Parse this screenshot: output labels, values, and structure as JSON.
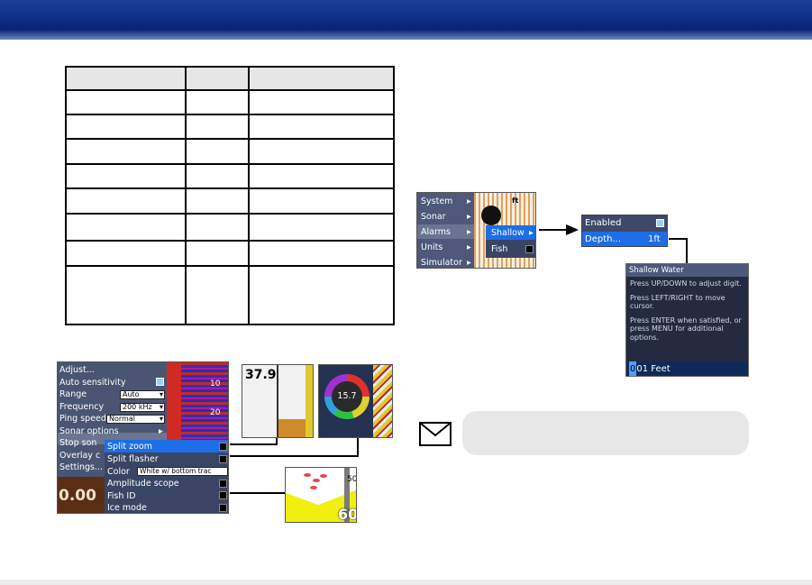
{
  "sonar_menu": {
    "items": [
      "Adjust...",
      "Auto sensitivity",
      "Range",
      "Frequency",
      "Ping speed",
      "Sonar options",
      "Stop son",
      "Overlay c",
      "Settings..."
    ],
    "range_value": "Auto",
    "frequency_value": "200 kHz",
    "ping_speed_value": "Normal",
    "depth_readout": "0.00",
    "scale_top": "10",
    "scale_mid": "20",
    "submenu": {
      "items": [
        "Split zoom",
        "Split flasher",
        "Color",
        "Amplitude scope",
        "Fish ID",
        "Ice mode"
      ],
      "color_value": "White w/ bottom trac"
    }
  },
  "thumbnails": {
    "split_zoom_depth": "37.9",
    "flasher_depth": "15.7",
    "fish_id_top_depth": "50",
    "fish_id_bottom_depth": "60"
  },
  "alarms_menu": {
    "items": [
      "System",
      "Sonar",
      "Alarms",
      "Units",
      "Simulator"
    ],
    "unit": "ft",
    "submenu": [
      "Shallow",
      "Fish"
    ]
  },
  "shallow_alarm": {
    "enabled_label": "Enabled",
    "depth_label": "Depth...",
    "depth_value": "1ft"
  },
  "shallow_water_dialog": {
    "title": "Shallow Water",
    "line1": "Press UP/DOWN to adjust digit.",
    "line2": "Press LEFT/RIGHT to move cursor.",
    "line3": "Press ENTER when satisfied, or press MENU for additional options.",
    "value_cursor_digit": "0",
    "value_rest": "01 Feet"
  },
  "icons": [
    "checkbox-checked-icon",
    "checkbox-empty-icon",
    "submenu-arrow-icon",
    "dropdown-arrow-icon",
    "envelope-icon"
  ],
  "colors": {
    "header_blue": "#0f2f86",
    "menu_highlight": "#1d6ee6",
    "note_gray": "#e7e7e7"
  }
}
